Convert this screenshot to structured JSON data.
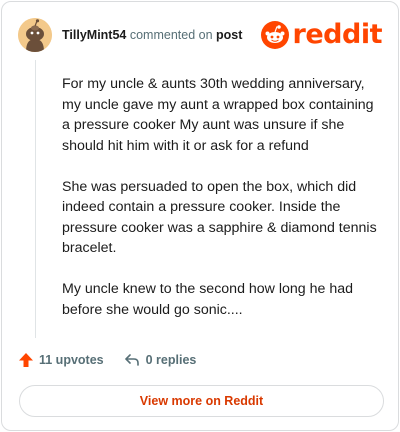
{
  "colors": {
    "brand": "#ff4500",
    "link": "#d93900",
    "muted": "#576f76",
    "border": "#dadcde"
  },
  "header": {
    "username": "TillyMint54",
    "action_text": "commented on",
    "post_link": "post",
    "avatar_icon": "snoo-avatar-icon",
    "logo_text": "reddit"
  },
  "comment": {
    "paragraphs": [
      "For my uncle & aunts 30th wedding anniversary, my uncle gave my aunt a wrapped box containing a pressure cooker My aunt was unsure if she should hit him with it or ask for a refund",
      "She was persuaded to open the box, which did indeed contain a pressure cooker. Inside the pressure cooker was a sapphire & diamond tennis bracelet.",
      "My uncle knew to the second how long he had before she would go sonic...."
    ]
  },
  "actions": {
    "upvotes_label": "11 upvotes",
    "upvote_icon": "upvote-arrow-icon",
    "replies_label": "0 replies",
    "reply_icon": "reply-arrow-icon"
  },
  "footer": {
    "view_more_label": "View more on Reddit"
  }
}
